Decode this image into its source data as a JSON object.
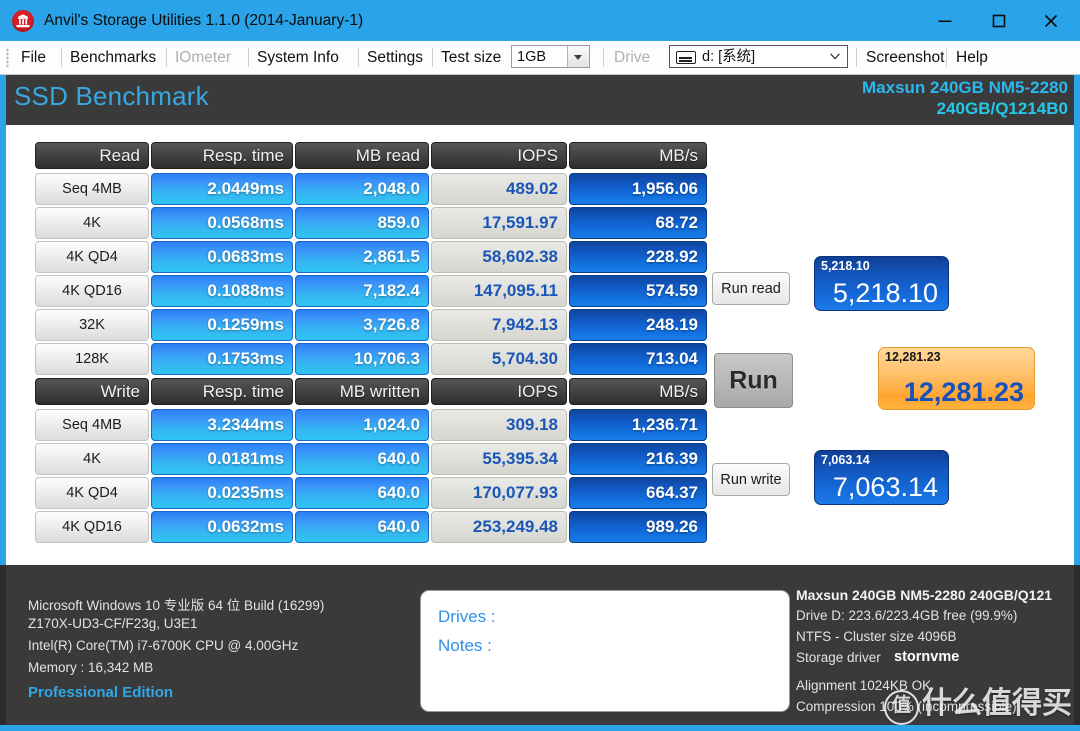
{
  "window": {
    "title": "Anvil's Storage Utilities 1.1.0 (2014-January-1)",
    "icon": "anvil-icon",
    "minimize": "–",
    "maximize": "□",
    "close": "✕"
  },
  "menu": {
    "items": [
      {
        "label": "File",
        "enabled": true
      },
      {
        "label": "Benchmarks",
        "enabled": true
      },
      {
        "label": "IOmeter",
        "enabled": false
      },
      {
        "label": "System Info",
        "enabled": true
      },
      {
        "label": "Settings",
        "enabled": true
      }
    ],
    "test_size_label": "Test size",
    "test_size_value": "1GB",
    "drive_label": "Drive",
    "drive_value": "d: [系统]",
    "screenshot": "Screenshot",
    "help": "Help"
  },
  "header": {
    "title": "SSD Benchmark",
    "device_line1": "Maxsun 240GB NM5-2280",
    "device_line2": "240GB/Q1214B0",
    "accent": "#37a8e0"
  },
  "read_table": {
    "headers": [
      "Read",
      "Resp. time",
      "MB read",
      "IOPS",
      "MB/s"
    ],
    "rows": [
      {
        "name": "Seq 4MB",
        "resp": "2.0449ms",
        "mb": "2,048.0",
        "iops": "489.02",
        "mbs": "1,956.06"
      },
      {
        "name": "4K",
        "resp": "0.0568ms",
        "mb": "859.0",
        "iops": "17,591.97",
        "mbs": "68.72"
      },
      {
        "name": "4K QD4",
        "resp": "0.0683ms",
        "mb": "2,861.5",
        "iops": "58,602.38",
        "mbs": "228.92"
      },
      {
        "name": "4K QD16",
        "resp": "0.1088ms",
        "mb": "7,182.4",
        "iops": "147,095.11",
        "mbs": "574.59"
      },
      {
        "name": "32K",
        "resp": "0.1259ms",
        "mb": "3,726.8",
        "iops": "7,942.13",
        "mbs": "248.19"
      },
      {
        "name": "128K",
        "resp": "0.1753ms",
        "mb": "10,706.3",
        "iops": "5,704.30",
        "mbs": "713.04"
      }
    ]
  },
  "write_table": {
    "headers": [
      "Write",
      "Resp. time",
      "MB written",
      "IOPS",
      "MB/s"
    ],
    "rows": [
      {
        "name": "Seq 4MB",
        "resp": "3.2344ms",
        "mb": "1,024.0",
        "iops": "309.18",
        "mbs": "1,236.71"
      },
      {
        "name": "4K",
        "resp": "0.0181ms",
        "mb": "640.0",
        "iops": "55,395.34",
        "mbs": "216.39"
      },
      {
        "name": "4K QD4",
        "resp": "0.0235ms",
        "mb": "640.0",
        "iops": "170,077.93",
        "mbs": "664.37"
      },
      {
        "name": "4K QD16",
        "resp": "0.0632ms",
        "mb": "640.0",
        "iops": "253,249.48",
        "mbs": "989.26"
      }
    ]
  },
  "controls": {
    "run_read": "Run read",
    "run": "Run",
    "run_write": "Run write"
  },
  "scores": {
    "read_small": "5,218.10",
    "read_big": "5,218.10",
    "total_small": "12,281.23",
    "total_big": "12,281.23",
    "write_small": "7,063.14",
    "write_big": "7,063.14"
  },
  "system": {
    "os": "Microsoft Windows 10 专业版 64 位 Build (16299)",
    "board": "Z170X-UD3-CF/F23g, U3E1",
    "cpu": "Intel(R) Core(TM) i7-6700K CPU @ 4.00GHz",
    "memory": "Memory : 16,342 MB",
    "edition": "Professional Edition"
  },
  "notes": {
    "drives_label": "Drives :",
    "notes_label": "Notes :"
  },
  "drive_info": {
    "model": "Maxsun 240GB NM5-2280 240GB/Q121",
    "capacity": "Drive D: 223.6/223.4GB free (99.9%)",
    "filesystem": "NTFS - Cluster size 4096B",
    "driver_label": "Storage driver",
    "driver_name": "stornvme",
    "alignment": "Alignment 1024KB OK",
    "compression": "Compression 100% (incompressible)"
  },
  "watermark": {
    "mark": "值",
    "text": "什么值得买"
  }
}
